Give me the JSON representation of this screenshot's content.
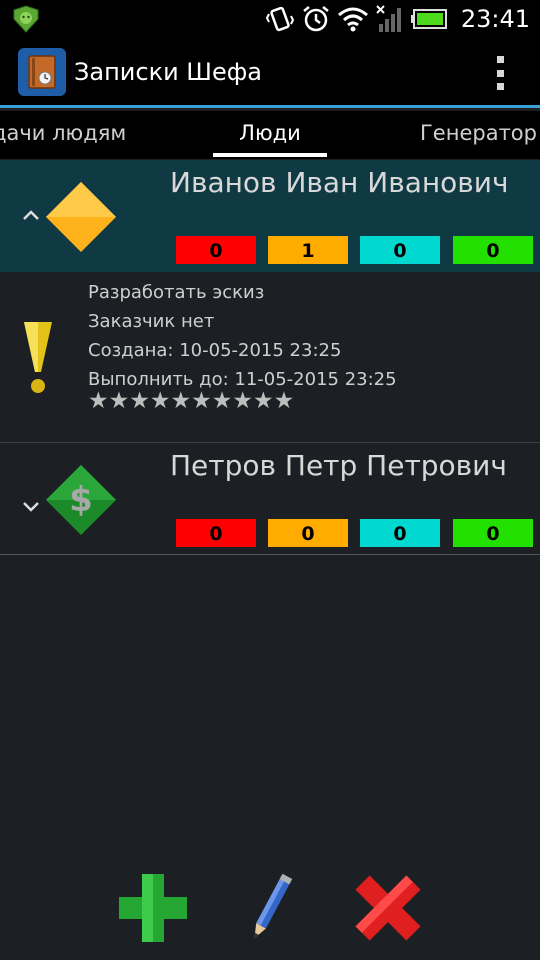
{
  "status_bar": {
    "time": "23:41",
    "icons": [
      "android-guard-icon",
      "vibrate-icon",
      "alarm-icon",
      "wifi-icon",
      "signal-icon",
      "battery-icon"
    ]
  },
  "action_bar": {
    "title": "Записки Шефа",
    "icons": [
      "app-notebook-icon",
      "overflow-menu-icon"
    ]
  },
  "tabs": [
    {
      "label": "дачи людям"
    },
    {
      "label": "Люди",
      "selected": true
    },
    {
      "label": "Генератор"
    }
  ],
  "groups": [
    {
      "name": "Иванов Иван Иванович",
      "expanded": true,
      "icon": "orange-diamond-icon",
      "counts": [
        "0",
        "1",
        "0",
        "0"
      ]
    },
    {
      "name": "Петров Петр Петрович",
      "expanded": false,
      "icon": "dollar-diamond-icon",
      "counts": [
        "0",
        "0",
        "0",
        "0"
      ]
    }
  ],
  "count_colors": [
    "#ff0000",
    "#ffab00",
    "#00d8d0",
    "#22e000"
  ],
  "task": {
    "title": "Разработать эскиз",
    "customer": "Заказчик  нет",
    "created": "Создана:  10-05-2015 23:25",
    "due": "Выполнить до:  11-05-2015 23:25",
    "rating_stars": "★★★★★★★★★★",
    "rating_filled": 0,
    "rating_max": 10,
    "icon": "exclamation-priority-icon"
  },
  "bottom_actions": [
    "add-icon",
    "edit-pencil-icon",
    "delete-icon"
  ]
}
